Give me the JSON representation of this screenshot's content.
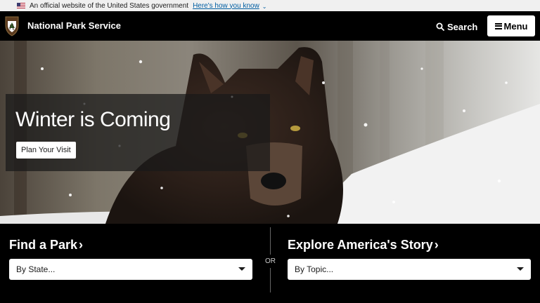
{
  "gov_banner": {
    "text": "An official website of the United States government",
    "link": "Here's how you know"
  },
  "header": {
    "brand": "National Park Service",
    "search_label": "Search",
    "menu_label": "Menu"
  },
  "hero": {
    "title": "Winter is Coming",
    "cta_label": "Plan Your Visit"
  },
  "find_park": {
    "title": "Find a Park",
    "select_value": "By State..."
  },
  "divider": {
    "label": "OR"
  },
  "explore": {
    "title": "Explore America's Story",
    "select_value": "By Topic..."
  },
  "colors": {
    "banner_bg": "#f0f0f0",
    "link": "#005ea2",
    "header_bg": "#000000",
    "text_light": "#ffffff"
  }
}
